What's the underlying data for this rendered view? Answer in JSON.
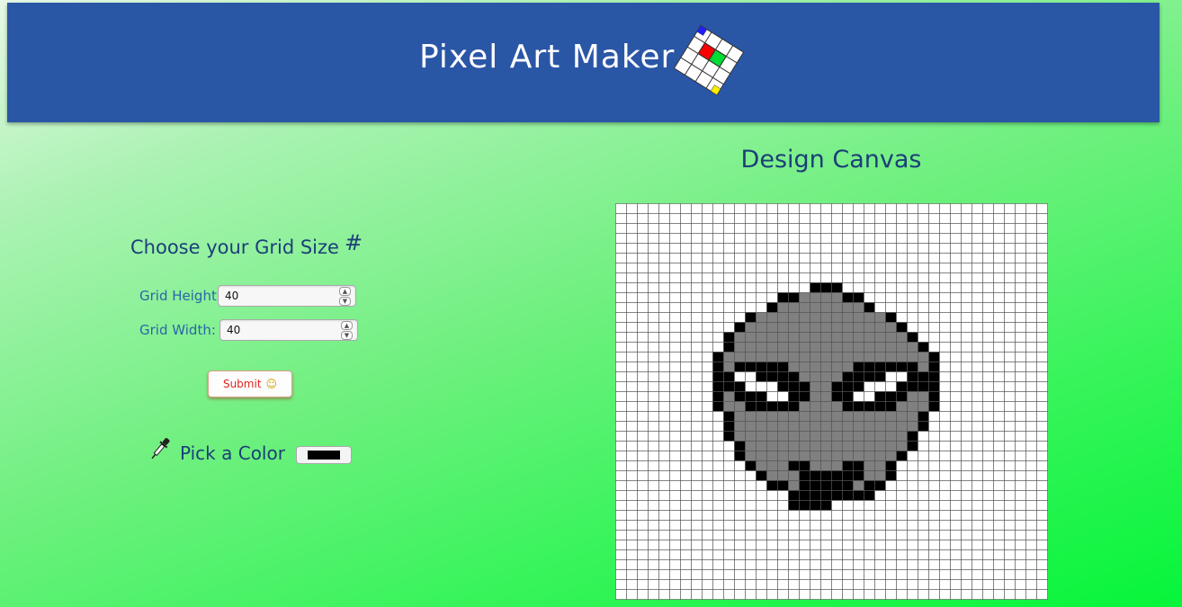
{
  "header": {
    "title": "Pixel Art Maker",
    "logo_icon": "pixel-grid-logo-icon",
    "background": "#2a56a6"
  },
  "controls": {
    "heading": "Choose your Grid Size",
    "heading_icon": "#",
    "grid_height_label": "Grid Height:",
    "grid_height_value": "40",
    "grid_width_label": "Grid Width:",
    "grid_width_value": "40",
    "submit_label": "Submit",
    "submit_emoji": "☺",
    "pick_color_label": "Pick a Color",
    "selected_color": "#000000"
  },
  "canvas": {
    "title": "Design Canvas",
    "rows": 40,
    "cols": 40,
    "gray_color": "#808080",
    "black_color": "#000000",
    "white_color": "#ffffff",
    "rows_data": [
      "........................................",
      "........................................",
      "........................................",
      "........................................",
      "........................................",
      "........................................",
      "........................................",
      "....................................... ",
      "..................KKK...................",
      "...............KKGGGGKK.................",
      "..............KGGGGGGGGK................",
      "............KGGGGGGGGGGGGK..............",
      "...........KGGGGGGGGGGGGGGK.............",
      "..........KGGGGGGGGGGGGGGGGK............",
      "..........KGGGGGGGGGGGGGGGGGK...........",
      ".........KGGGGGGGGGGGGGGGGGGGK..........",
      ".........KGKKKKKGGGGGGKKKKKKGK..........",
      ".........KKWWKKKKGGGGKKKKWWKKK..........",
      ".........KKKWWWKKKGGKKKWWWKKKK..........",
      ".........KGKKKWWKKGGKKWWKKKGGK..........",
      ".........KGGKKKKKGGGGKKKKKGGGK..........",
      "..........KGGGGGGGGGGGGGGGGGK...........",
      "..........KGGGGGGGGGGGGGGGGGK...........",
      "..........KGGGGGGGGGGGGGGGGK............",
      "...........KGGGGGGGGGGGGGGGK............",
      "...........KGGGGGGGGGGGGGGK.............",
      "............KGGGKKGGGKKGGK..............",
      ".............KGGGKKKKKKGGK..............",
      "..............KKGKKKKKGKK...............",
      "................KKKKKKKK................",
      "................KKKK....................",
      "........................................",
      "........................................",
      "........................................",
      "........................................",
      "........................................",
      "........................................",
      "........................................",
      "........................................",
      "........................................"
    ]
  }
}
